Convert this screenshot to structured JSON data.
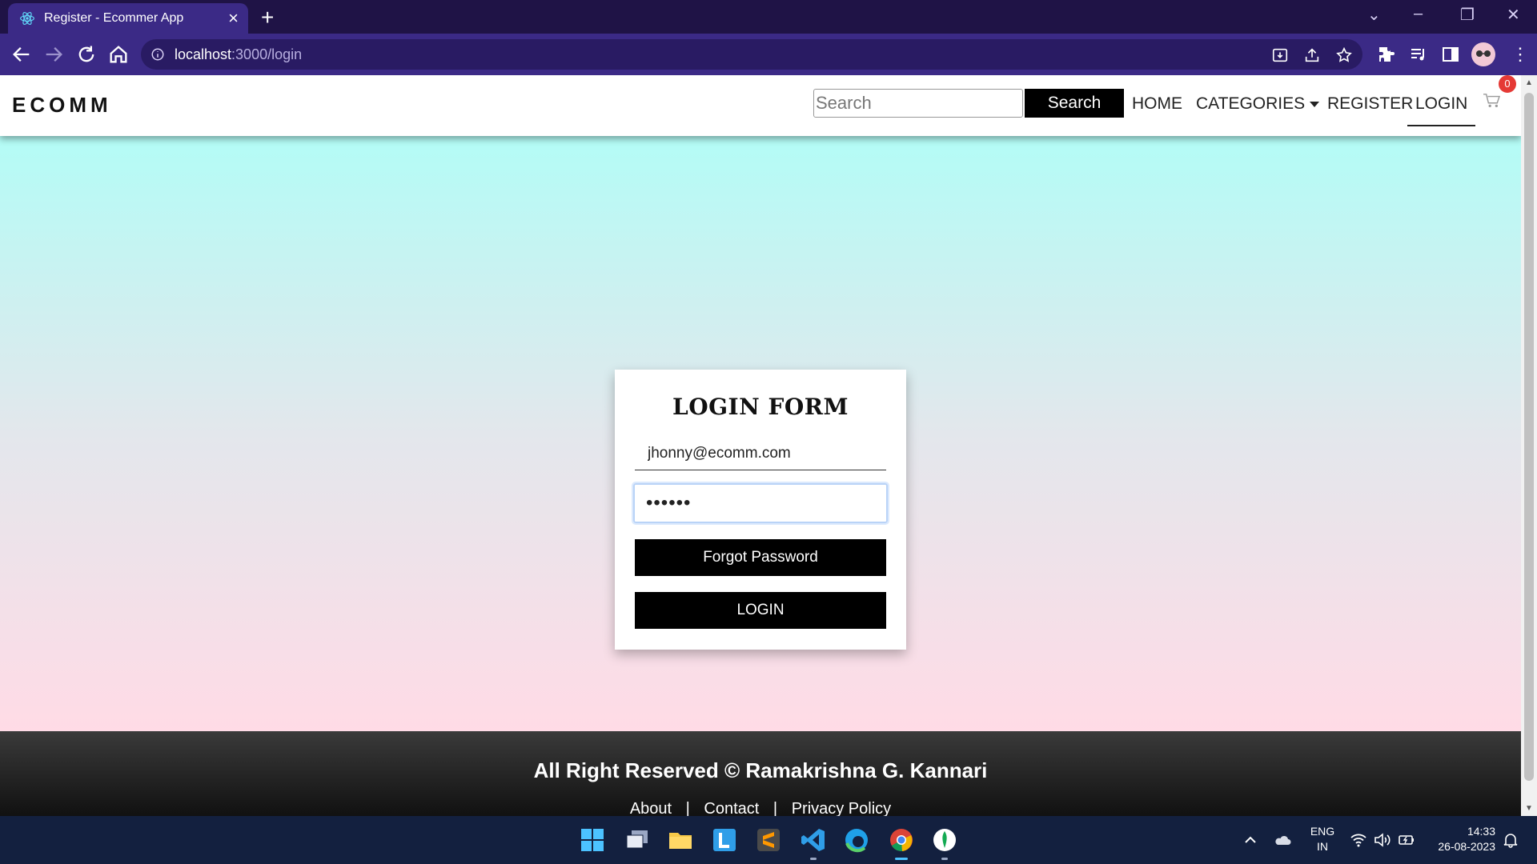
{
  "browser": {
    "tab_title": "Register - Ecommer App",
    "url_host": "localhost",
    "url_rest": ":3000/login"
  },
  "site": {
    "brand": "ECOMM",
    "search_placeholder": "Search",
    "search_button": "Search",
    "nav": {
      "home": "HOME",
      "categories": "CATEGORIES",
      "register": "REGISTER",
      "login": "LOGIN"
    },
    "cart_count": "0",
    "active_nav": "LOGIN"
  },
  "login_form": {
    "title": "LOGIN FORM",
    "email_value": "jhonny@ecomm.com",
    "password_value": "••••••",
    "forgot_label": "Forgot Password",
    "login_label": "LOGIN"
  },
  "footer": {
    "copyright": "All Right Reserved © Ramakrishna G. Kannari",
    "links": [
      "About",
      "Contact",
      "Privacy Policy"
    ],
    "separator": "|"
  },
  "taskbar": {
    "lang_line1": "ENG",
    "lang_line2": "IN",
    "time": "14:33",
    "date": "26-08-2023"
  },
  "colors": {
    "browser_frame": "#1f1346",
    "browser_toolbar": "#3b2a86",
    "hero_top": "#b3fcf6",
    "hero_bottom": "#ffdbe6",
    "button": "#000000",
    "badge": "#e53935",
    "taskbar": "#13203f"
  }
}
